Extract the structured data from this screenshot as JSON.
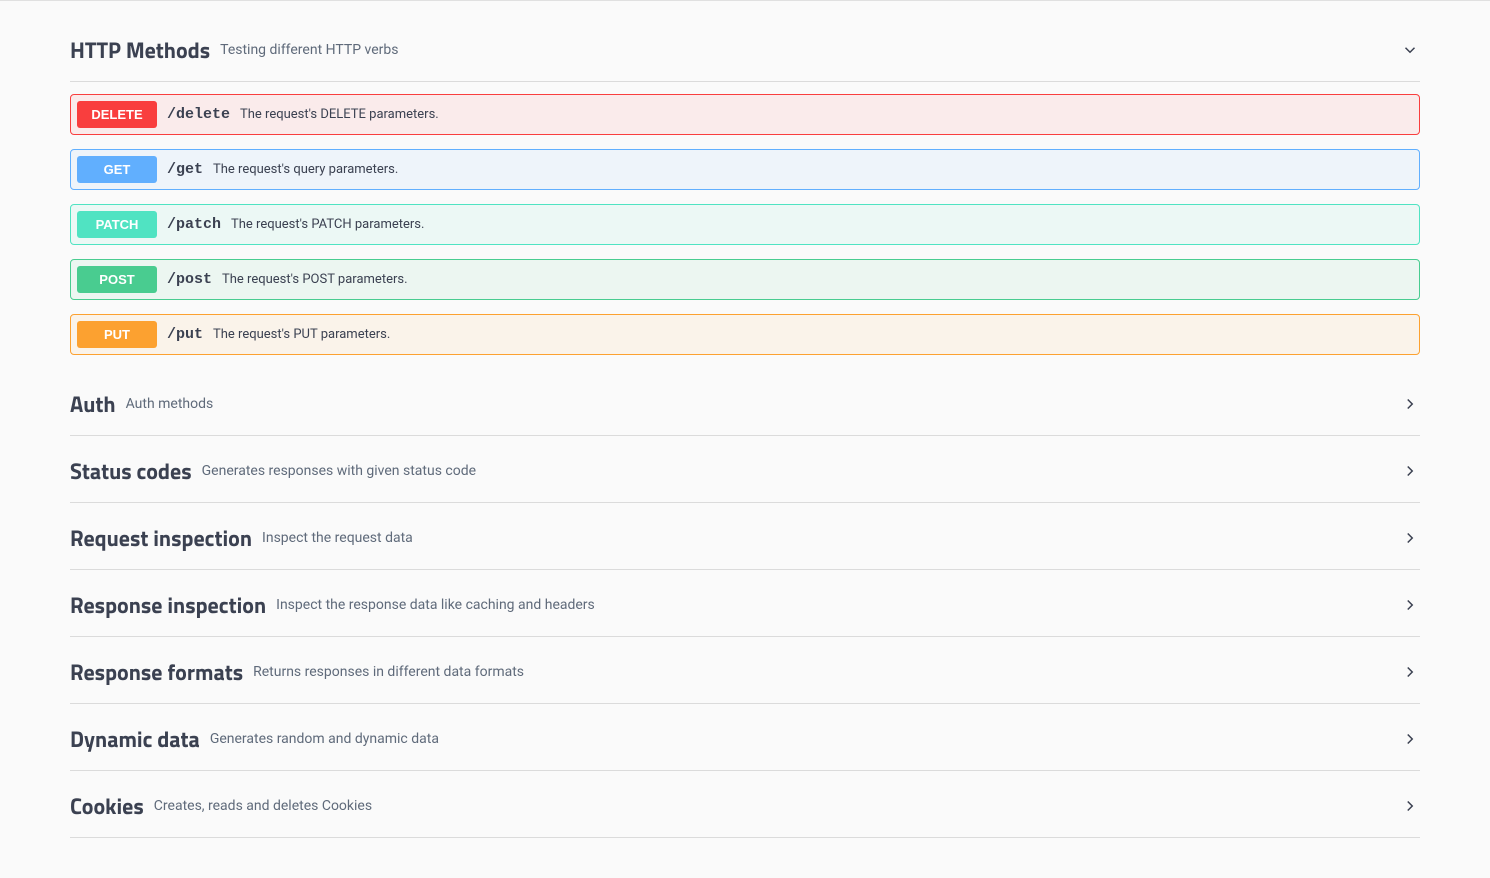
{
  "sections": [
    {
      "id": "http-methods",
      "title": "HTTP Methods",
      "desc": "Testing different HTTP verbs",
      "expanded": true,
      "operations": [
        {
          "method": "DELETE",
          "class": "op-delete",
          "path": "/delete",
          "summary": "The request's DELETE parameters."
        },
        {
          "method": "GET",
          "class": "op-get",
          "path": "/get",
          "summary": "The request's query parameters."
        },
        {
          "method": "PATCH",
          "class": "op-patch",
          "path": "/patch",
          "summary": "The request's PATCH parameters."
        },
        {
          "method": "POST",
          "class": "op-post",
          "path": "/post",
          "summary": "The request's POST parameters."
        },
        {
          "method": "PUT",
          "class": "op-put",
          "path": "/put",
          "summary": "The request's PUT parameters."
        }
      ]
    },
    {
      "id": "auth",
      "title": "Auth",
      "desc": "Auth methods",
      "expanded": false
    },
    {
      "id": "status-codes",
      "title": "Status codes",
      "desc": "Generates responses with given status code",
      "expanded": false
    },
    {
      "id": "request-inspection",
      "title": "Request inspection",
      "desc": "Inspect the request data",
      "expanded": false
    },
    {
      "id": "response-inspection",
      "title": "Response inspection",
      "desc": "Inspect the response data like caching and headers",
      "expanded": false
    },
    {
      "id": "response-formats",
      "title": "Response formats",
      "desc": "Returns responses in different data formats",
      "expanded": false
    },
    {
      "id": "dynamic-data",
      "title": "Dynamic data",
      "desc": "Generates random and dynamic data",
      "expanded": false
    },
    {
      "id": "cookies",
      "title": "Cookies",
      "desc": "Creates, reads and deletes Cookies",
      "expanded": false
    }
  ]
}
